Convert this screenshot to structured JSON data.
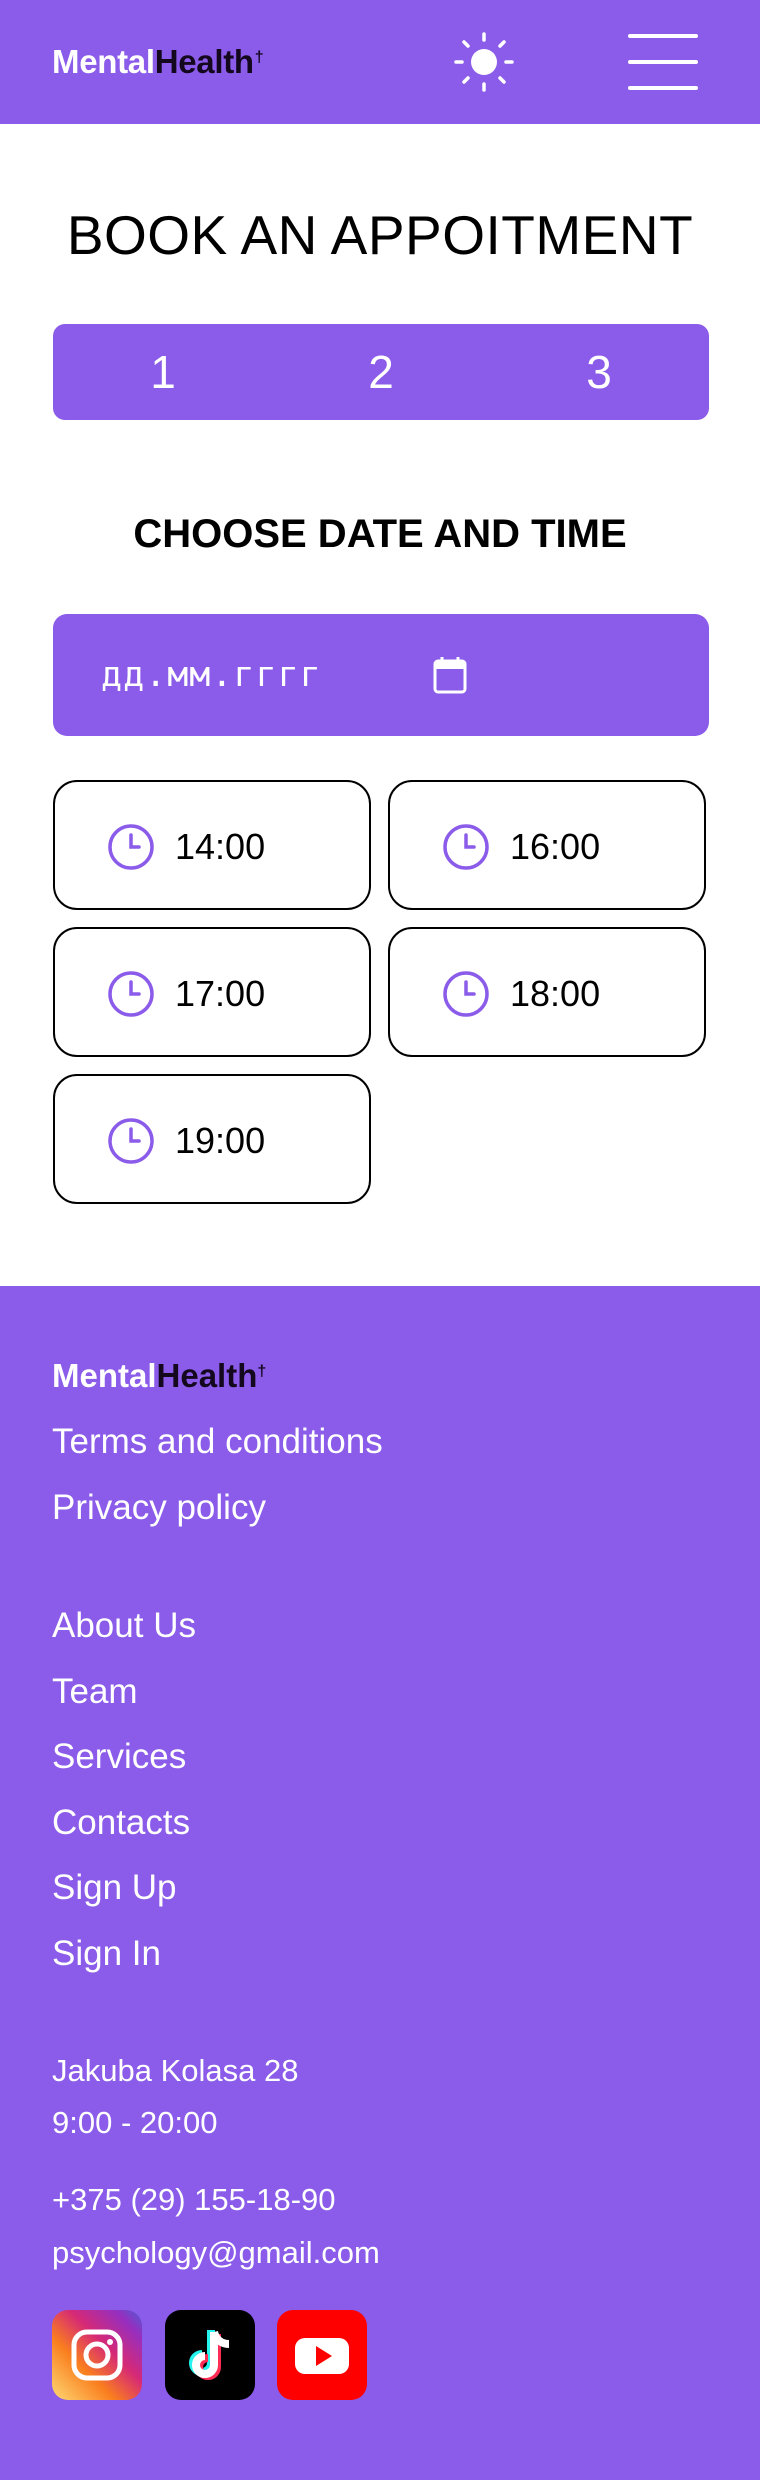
{
  "header": {
    "logo_part1": "Mental",
    "logo_part2": "Health",
    "logo_mark": "†",
    "theme_icon": "sun-icon",
    "menu_icon": "hamburger-menu-icon"
  },
  "main": {
    "title": "BOOK AN APPOITMENT",
    "steps": [
      "1",
      "2",
      "3"
    ],
    "subtitle": "CHOOSE DATE AND TIME",
    "date_placeholder": "дд.мм.гггг",
    "date_icon": "calendar-icon",
    "time_slots": [
      "14:00",
      "16:00",
      "17:00",
      "18:00",
      "19:00"
    ],
    "slot_icon": "clock-icon"
  },
  "footer": {
    "logo_part1": "Mental",
    "logo_part2": "Health",
    "logo_mark": "†",
    "legal_links": [
      "Terms and conditions",
      "Privacy policy"
    ],
    "nav_links": [
      "About Us",
      "Team",
      "Services",
      "Contacts",
      "Sign Up",
      "Sign In"
    ],
    "address": "Jakuba Kolasa 28",
    "hours": "9:00 - 20:00",
    "phone": "+375 (29) 155-18-90",
    "email": "psychology@gmail.com",
    "social": [
      "instagram-icon",
      "tiktok-icon",
      "youtube-icon"
    ]
  },
  "colors": {
    "accent": "#8b5bea",
    "white": "#ffffff",
    "logo_dark": "#14081f"
  }
}
